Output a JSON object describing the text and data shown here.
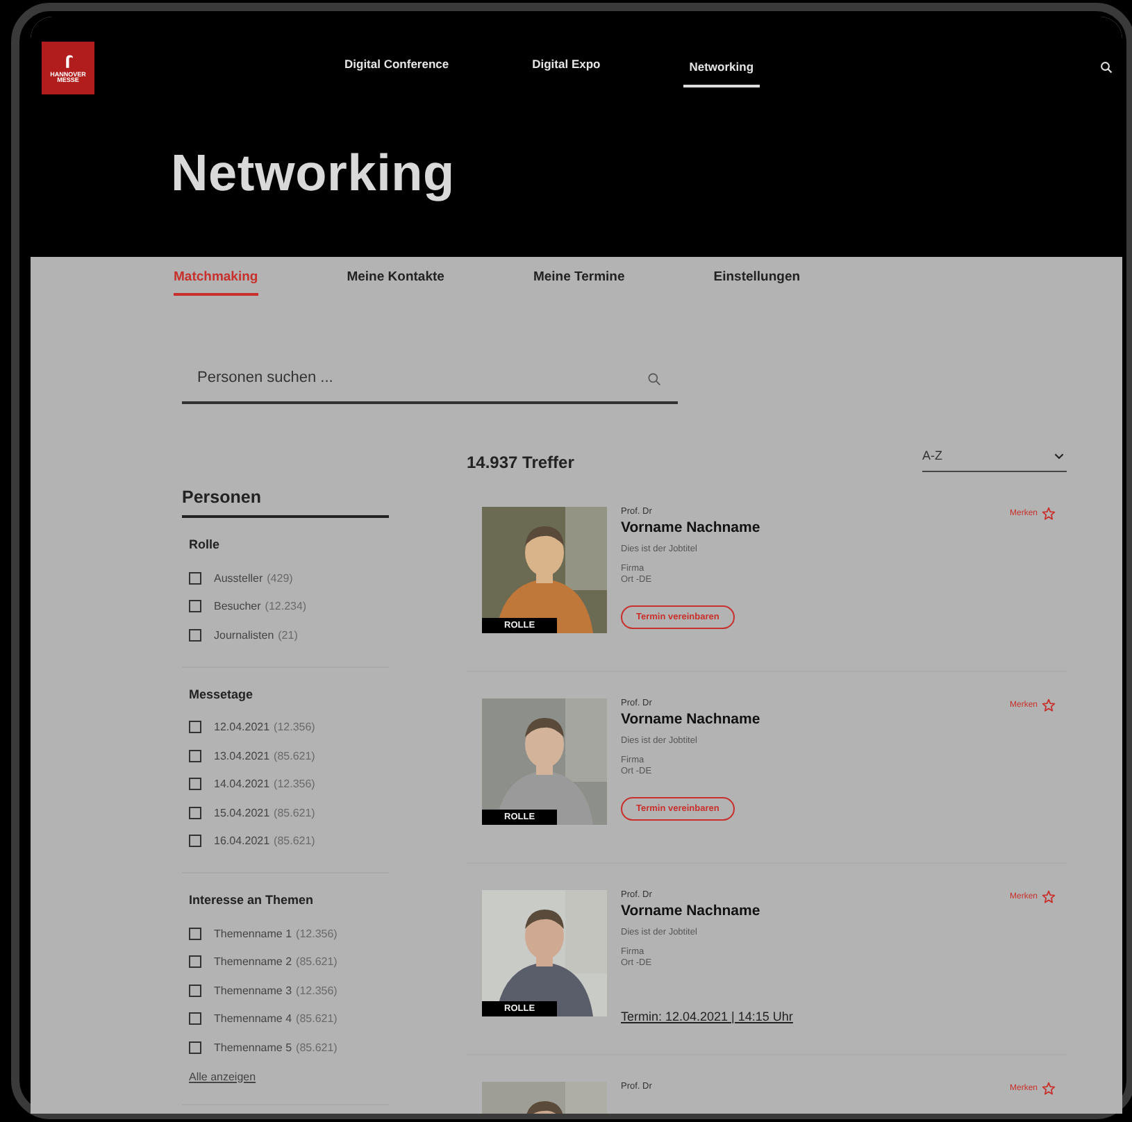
{
  "logo": {
    "text": "HANNOVER MESSE"
  },
  "nav": [
    {
      "label": "Digital Conference",
      "selected": false
    },
    {
      "label": "Digital Expo",
      "selected": false
    },
    {
      "label": "Networking",
      "selected": true
    }
  ],
  "page_title": "Networking",
  "tabs": [
    {
      "label": "Matchmaking",
      "selected": true
    },
    {
      "label": "Meine Kontakte",
      "selected": false
    },
    {
      "label": "Meine Termine",
      "selected": false
    },
    {
      "label": "Einstellungen",
      "selected": false
    }
  ],
  "search": {
    "placeholder": "Personen suchen ..."
  },
  "sidebar": {
    "title": "Personen",
    "groups": [
      {
        "title": "Rolle",
        "items": [
          {
            "label": "Aussteller",
            "count": "(429)",
            "checked": false
          },
          {
            "label": "Besucher",
            "count": "(12.234)",
            "checked": false
          },
          {
            "label": "Journalisten",
            "count": "(21)",
            "checked": false
          }
        ]
      },
      {
        "title": "Messetage",
        "items": [
          {
            "label": "12.04.2021",
            "count": "(12.356)",
            "checked": false
          },
          {
            "label": "13.04.2021",
            "count": "(85.621)",
            "checked": false
          },
          {
            "label": "14.04.2021",
            "count": "(12.356)",
            "checked": false
          },
          {
            "label": "15.04.2021",
            "count": "(85.621)",
            "checked": false
          },
          {
            "label": "16.04.2021",
            "count": "(85.621)",
            "checked": false
          }
        ]
      },
      {
        "title": "Interesse an Themen",
        "items": [
          {
            "label": "Themenname 1",
            "count": "(12.356)",
            "checked": false
          },
          {
            "label": "Themenname 2",
            "count": "(85.621)",
            "checked": false
          },
          {
            "label": "Themenname 3",
            "count": "(12.356)",
            "checked": false
          },
          {
            "label": "Themenname 4",
            "count": "(85.621)",
            "checked": false
          },
          {
            "label": "Themenname 5",
            "count": "(85.621)",
            "checked": false
          }
        ],
        "show_all": "Alle anzeigen"
      }
    ]
  },
  "results": {
    "count": "14.937 Treffer",
    "sort": "A-Z"
  },
  "people": [
    {
      "kind": "button",
      "title": "Prof. Dr",
      "name": "Vorname Nachname",
      "job": "Dies ist der Jobtitel",
      "company": "Firma",
      "location": "Ort -DE",
      "role": "ROLLE",
      "bookmark": "Merken",
      "action": "Termin vereinbaren"
    },
    {
      "kind": "button",
      "title": "Prof. Dr",
      "name": "Vorname Nachname",
      "job": "Dies ist der Jobtitel",
      "company": "Firma",
      "location": "Ort -DE",
      "role": "ROLLE",
      "bookmark": "Merken",
      "action": "Termin vereinbaren"
    },
    {
      "kind": "appointment",
      "title": "Prof. Dr",
      "name": "Vorname Nachname",
      "job": "Dies ist der Jobtitel",
      "company": "Firma",
      "location": "Ort -DE",
      "role": "ROLLE",
      "bookmark": "Merken",
      "action": "Termin: 12.04.2021 | 14:15 Uhr"
    },
    {
      "kind": "partial",
      "title": "Prof. Dr",
      "bookmark": "Merken"
    }
  ]
}
